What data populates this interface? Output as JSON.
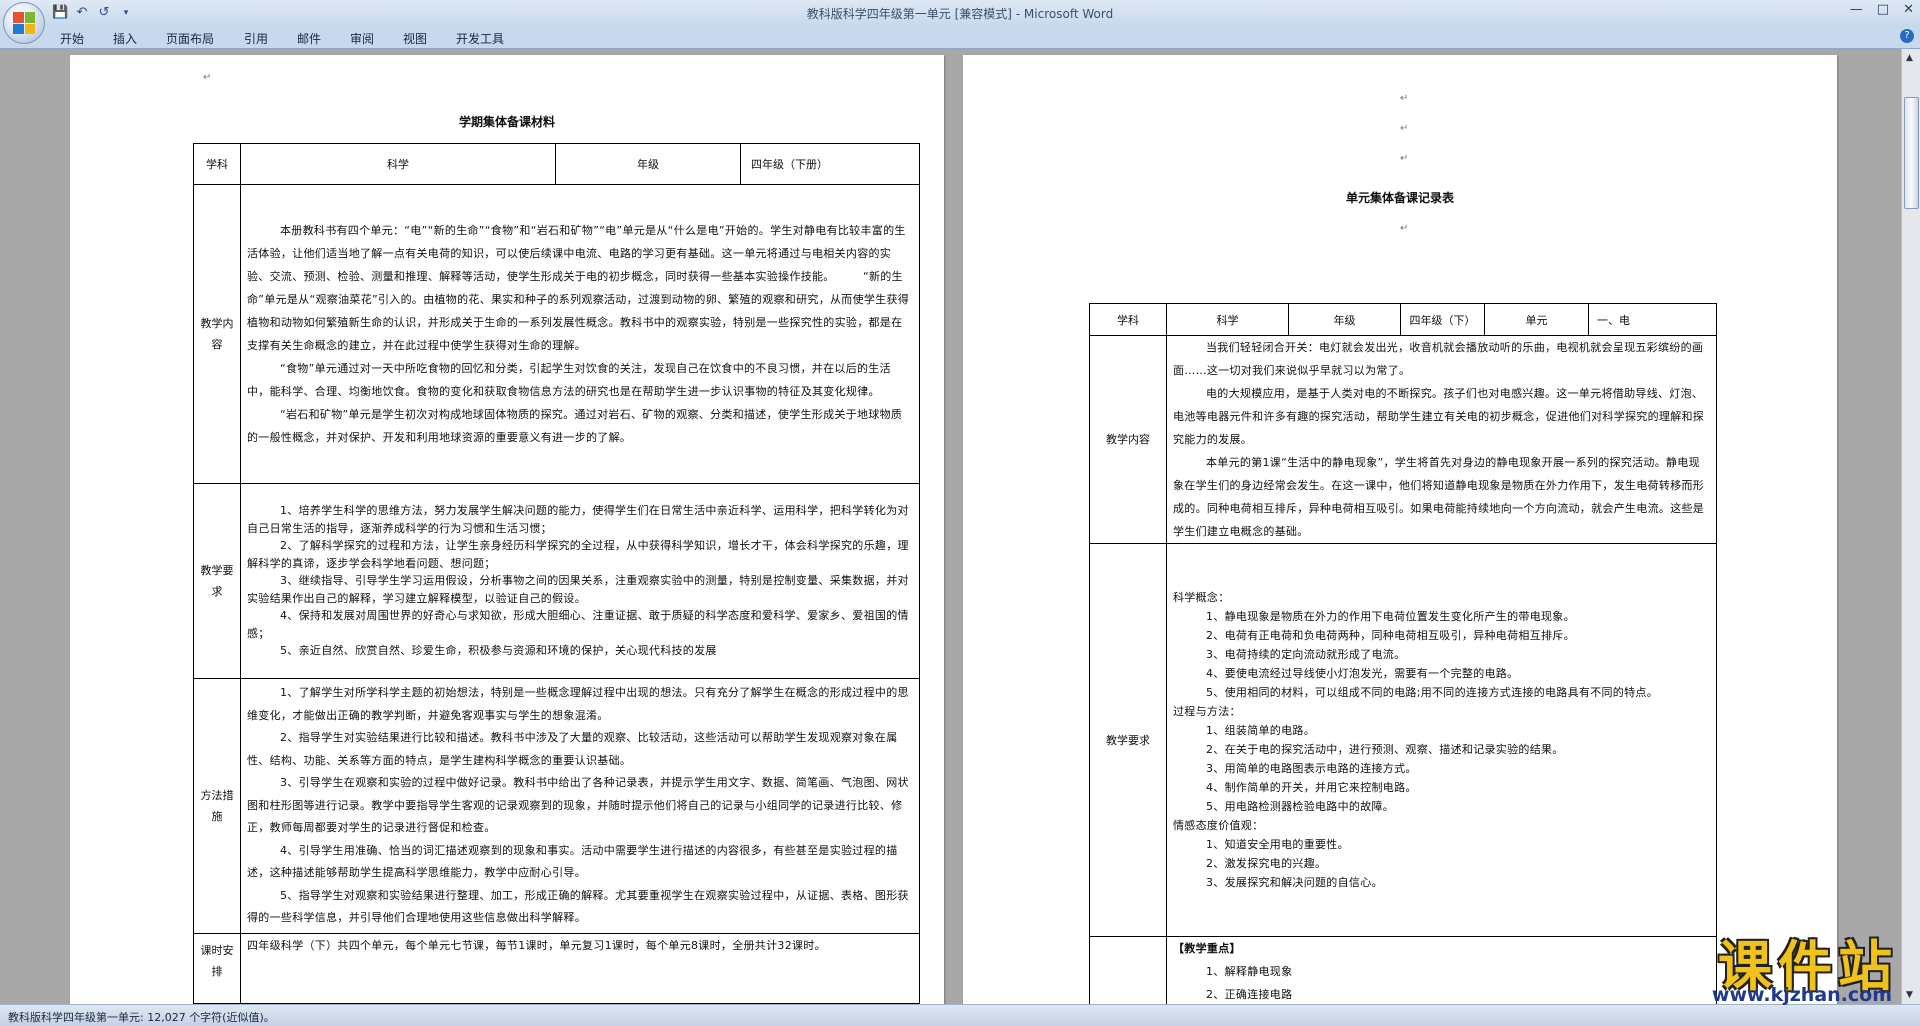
{
  "window": {
    "title": "教科版科学四年级第一单元 [兼容模式] - Microsoft Word",
    "minimize_icon": "minimize-icon",
    "maximize_icon": "maximize-icon",
    "close_icon": "close-icon"
  },
  "quick_access": [
    "save-icon",
    "undo-icon",
    "redo-icon",
    "customize-icon"
  ],
  "ribbon": {
    "tabs": [
      "开始",
      "插入",
      "页面布局",
      "引用",
      "邮件",
      "审阅",
      "视图",
      "开发工具"
    ],
    "help": "?"
  },
  "page1": {
    "title": "学期集体备课材料",
    "header_row": [
      "学科",
      "科学",
      "年级",
      "四年级（下册）"
    ],
    "rows": [
      {
        "label": "教学内容",
        "paragraphs": [
          "本册教科书有四个单元：“电”“新的生命”“食物”和“岩石和矿物”“电”单元是从“什么是电”开始的。学生对静电有比较丰富的生活体验，让他们适当地了解一点有关电荷的知识，可以使后续课中电流、电路的学习更有基础。这一单元将通过与电相关内容的实验、交流、预测、检验、测量和推理、解释等活动，使学生形成关于电的初步概念，同时获得一些基本实验操作技能。　　　“新的生命”单元是从“观察油菜花”引入的。由植物的花、果实和种子的系列观察活动，过渡到动物的卵、繁殖的观察和研究，从而使学生获得植物和动物如何繁殖新生命的认识，并形成关于生命的一系列发展性概念。教科书中的观察实验，特别是一些探究性的实验，都是在支撑有关生命概念的建立，并在此过程中使学生获得对生命的理解。",
          "“食物”单元通过对一天中所吃食物的回忆和分类，引起学生对饮食的关注，发现自己在饮食中的不良习惯，并在以后的生活中，能科学、合理、均衡地饮食。食物的变化和获取食物信息方法的研究也是在帮助学生进一步认识事物的特征及其变化规律。",
          "“岩石和矿物”单元是学生初次对构成地球固体物质的探究。通过对岩石、矿物的观察、分类和描述，使学生形成关于地球物质的一般性概念，并对保护、开发和利用地球资源的重要意义有进一步的了解。"
        ]
      },
      {
        "label": "教学要求",
        "paragraphs": [
          "1、培养学生科学的思维方法，努力发展学生解决问题的能力，使得学生们在日常生活中亲近科学、运用科学，把科学转化为对自己日常生活的指导，逐渐养成科学的行为习惯和生活习惯；",
          "2、了解科学探究的过程和方法，让学生亲身经历科学探究的全过程，从中获得科学知识，增长才干，体会科学探究的乐趣，理解科学的真谛，逐步学会科学地看问题、想问题；",
          "3、继续指导、引导学生学习运用假设，分析事物之间的因果关系，注重观察实验中的测量，特别是控制变量、采集数据，并对实验结果作出自己的解释，学习建立解释模型，以验证自己的假设。",
          "4、保持和发展对周围世界的好奇心与求知欲，形成大胆细心、注重证据、敢于质疑的科学态度和爱科学、爱家乡、爱祖国的情感；",
          "5、亲近自然、欣赏自然、珍爱生命，积极参与资源和环境的保护，关心现代科技的发展"
        ]
      },
      {
        "label": "方法措施",
        "paragraphs": [
          "1、了解学生对所学科学主题的初始想法，特别是一些概念理解过程中出现的想法。只有充分了解学生在概念的形成过程中的思维变化，才能做出正确的教学判断，并避免客观事实与学生的想象混淆。",
          "2、指导学生对实验结果进行比较和描述。教科书中涉及了大量的观察、比较活动，这些活动可以帮助学生发现观察对象在属性、结构、功能、关系等方面的特点，是学生建构科学概念的重要认识基础。",
          "3、引导学生在观察和实验的过程中做好记录。教科书中给出了各种记录表，并提示学生用文字、数据、简笔画、气泡图、网状图和柱形图等进行记录。教学中要指导学生客观的记录观察到的现象，并随时提示他们将自己的记录与小组同学的记录进行比较、修正，教师每周都要对学生的记录进行督促和检查。",
          "4、引导学生用准确、恰当的词汇描述观察到的现象和事实。活动中需要学生进行描述的内容很多，有些甚至是实验过程的描述，这种描述能够帮助学生提高科学思维能力，教学中应耐心引导。",
          "5、指导学生对观察和实验结果进行整理、加工，形成正确的解释。尤其要重视学生在观察实验过程中，从证据、表格、图形获得的一些科学信息，并引导他们合理地使用这些信息做出科学解释。"
        ]
      },
      {
        "label": "课时安排",
        "paragraphs": [
          "四年级科学（下）共四个单元，每个单元七节课，每节1课时，单元复习1课时，每个单元8课时，全册共计32课时。"
        ]
      }
    ]
  },
  "page2": {
    "title": "单元集体备课记录表",
    "header_row": [
      "学科",
      "科学",
      "年级",
      "四年级（下）",
      "单元",
      "一、电"
    ],
    "content_label": "教学内容",
    "content": [
      "当我们轻轻闭合开关：电灯就会发出光，收音机就会播放动听的乐曲，电视机就会呈现五彩缤纷的画面……这一切对我们来说似乎早就习以为常了。",
      "电的大规模应用，是基于人类对电的不断探究。孩子们也对电感兴趣。这一单元将借助导线、灯泡、电池等电器元件和许多有趣的探究活动，帮助学生建立有关电的初步概念，促进他们对科学探究的理解和探究能力的发展。",
      "本单元的第1课“生活中的静电现象”，学生将首先对身边的静电现象开展一系列的探究活动。静电现象在学生们的身边经常会发生。在这一课中，他们将知道静电现象是物质在外力作用下，发生电荷转移而形成的。同种电荷相互排斥，异种电荷相互吸引。如果电荷能持续地向一个方向流动，就会产生电流。这些是学生们建立电概念的基础。"
    ],
    "req_label": "教学要求",
    "requirements": [
      {
        "text": "科学概念：",
        "indent": false
      },
      {
        "text": "1、静电现象是物质在外力的作用下电荷位置发生变化所产生的带电现象。",
        "indent": true
      },
      {
        "text": "2、电荷有正电荷和负电荷两种，同种电荷相互吸引，异种电荷相互排斥。",
        "indent": true
      },
      {
        "text": "3、电荷持续的定向流动就形成了电流。",
        "indent": true
      },
      {
        "text": "4、要使电流经过导线使小灯泡发光，需要有一个完整的电路。",
        "indent": true
      },
      {
        "text": "5、使用相同的材料，可以组成不同的电路;用不同的连接方式连接的电路具有不同的特点。",
        "indent": true
      },
      {
        "text": "过程与方法：",
        "indent": false
      },
      {
        "text": "1、组装简单的电路。",
        "indent": true
      },
      {
        "text": "2、在关于电的探究活动中，进行预测、观察、描述和记录实验的结果。",
        "indent": true
      },
      {
        "text": "3、用简单的电路图表示电路的连接方式。",
        "indent": true
      },
      {
        "text": "4、制作简单的开关，并用它来控制电路。",
        "indent": true
      },
      {
        "text": "5、用电路检测器检验电路中的故障。",
        "indent": true
      },
      {
        "text": "情感态度价值观：",
        "indent": false
      },
      {
        "text": "1、知道安全用电的重要性。",
        "indent": true
      },
      {
        "text": "2、激发探究电的兴趣。",
        "indent": true
      },
      {
        "text": "3、发展探究和解决问题的自信心。",
        "indent": true
      }
    ],
    "key_title": "【教学重点】",
    "key_points": [
      "1、解释静电现象",
      "2、正确连接电路"
    ]
  },
  "statusbar": {
    "text": "教科版科学四年级第一单元: 12,027 个字符(近似值)。"
  },
  "watermark": {
    "text": "课件站",
    "url": "www.kjzhan.com"
  }
}
